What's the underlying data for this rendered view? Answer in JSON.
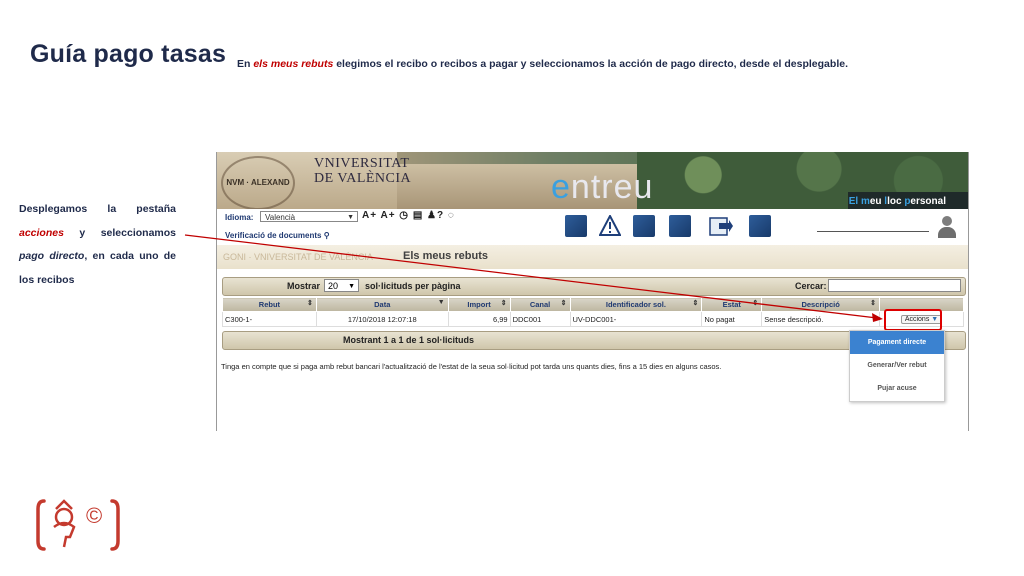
{
  "slide": {
    "title": "Guía pago tasas",
    "subtitle_pre": "En ",
    "subtitle_em": "els meus rebuts",
    "subtitle_post": "  elegimos el recibo o recibos a pagar y seleccionamos la acción de pago directo, desde el desplegable.",
    "side_text_1": "Desplegamos la pestaña ",
    "side_text_em1": "acciones",
    "side_text_2": " y seleccionamos ",
    "side_text_em2": "pago directo",
    "side_text_3": ", en cada uno de los recibos",
    "accent_color": "#c00000",
    "text_color": "#1f2a4a"
  },
  "banner": {
    "seal_text": "NVM · ALEXAND",
    "uv_line1": "VNIVERSITAT",
    "uv_line2": "DE VALÈNCIA",
    "app_e": "e",
    "app_rest": "ntreu",
    "personal_hl1": "El",
    "personal_t1": " ",
    "personal_hl2": "m",
    "personal_t2": "eu ",
    "personal_hl3": "l",
    "personal_t3": "loc ",
    "personal_hl4": "p",
    "personal_t4": "ersonal"
  },
  "toolbar": {
    "idioma_label": "Idioma:",
    "idioma_value": "Valencià",
    "tools": "A+ A+ ◷ ▤ ♟? ◌",
    "verification": "Verificació de documents"
  },
  "section": {
    "seal_text": "GONI  ·  VNIVERSITAT  DE VALÈNCIA",
    "title": "Els meus rebuts"
  },
  "controls": {
    "show_label": "Mostrar",
    "page_size": "20",
    "per_page_label": "sol·licituds per pàgina",
    "search_label": "Cercar:",
    "search_value": ""
  },
  "table": {
    "headers": [
      "Rebut",
      "Data",
      "Import",
      "Canal",
      "Identificador sol.",
      "Estat",
      "Descripció",
      ""
    ],
    "rows": [
      [
        "C300-1-",
        "17/10/2018 12:07:18",
        "6,99",
        "DDC001",
        "UV-DDC001-",
        "No pagat",
        "Sense descripció.",
        "Accions"
      ]
    ]
  },
  "summary": "Mostrant 1 a 1 de 1 sol·licituds",
  "note": "Tinga en compte que si paga amb rebut bancari l'actualització de l'estat de la seua sol·licitud pot tarda uns quants dies, fins a 15 dies en alguns casos.",
  "dropdown": {
    "items": [
      "Pagament directe",
      "Generar/Ver rebut",
      "Pujar acuse"
    ],
    "selected": "Pagament directe"
  },
  "logo_mark": "©"
}
